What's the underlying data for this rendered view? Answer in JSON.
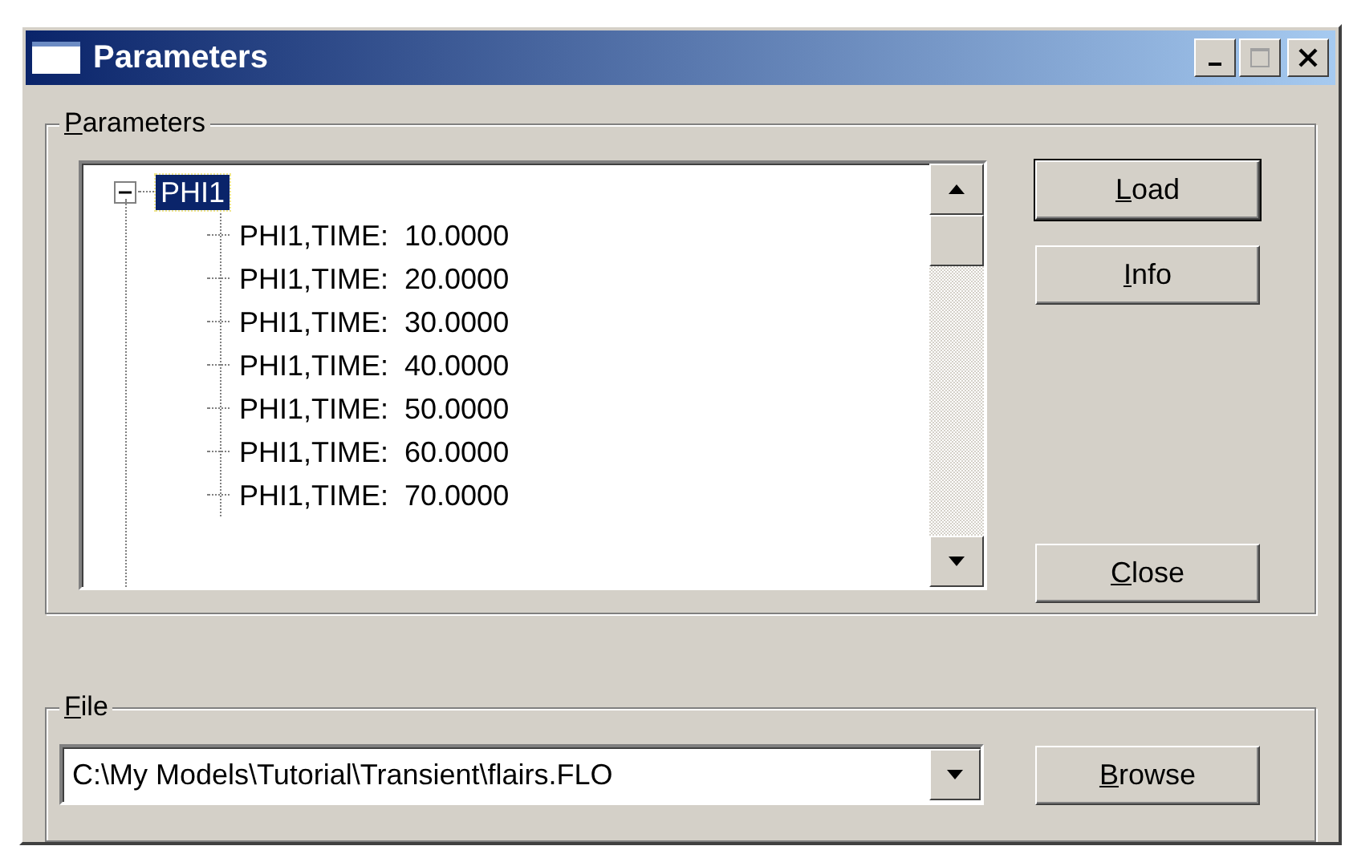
{
  "window": {
    "title": "Parameters"
  },
  "parameters_group": {
    "label": "Parameters",
    "tree": [
      {
        "label": "PHI1",
        "expanded": true,
        "selected": true,
        "children": [
          {
            "label": "PHI1,TIME:  10.0000",
            "selected": false
          },
          {
            "label": "PHI1,TIME:  20.0000",
            "selected": false
          },
          {
            "label": "PHI1,TIME:  30.0000",
            "selected": false
          },
          {
            "label": "PHI1,TIME:  40.0000",
            "selected": false
          },
          {
            "label": "PHI1,TIME:  50.0000",
            "selected": false
          },
          {
            "label": "PHI1,TIME:  60.0000",
            "selected": false
          },
          {
            "label": "PHI1,TIME:  70.0000",
            "selected": false
          }
        ]
      }
    ],
    "buttons": [
      {
        "label": "Load",
        "default": true
      },
      {
        "label": "Info",
        "default": false
      }
    ],
    "close_button": {
      "label": "Close"
    }
  },
  "file_group": {
    "label": "File",
    "value": "C:\\My Models\\Tutorial\\Transient\\flairs.FLO",
    "browse_button": {
      "label": "Browse"
    }
  }
}
